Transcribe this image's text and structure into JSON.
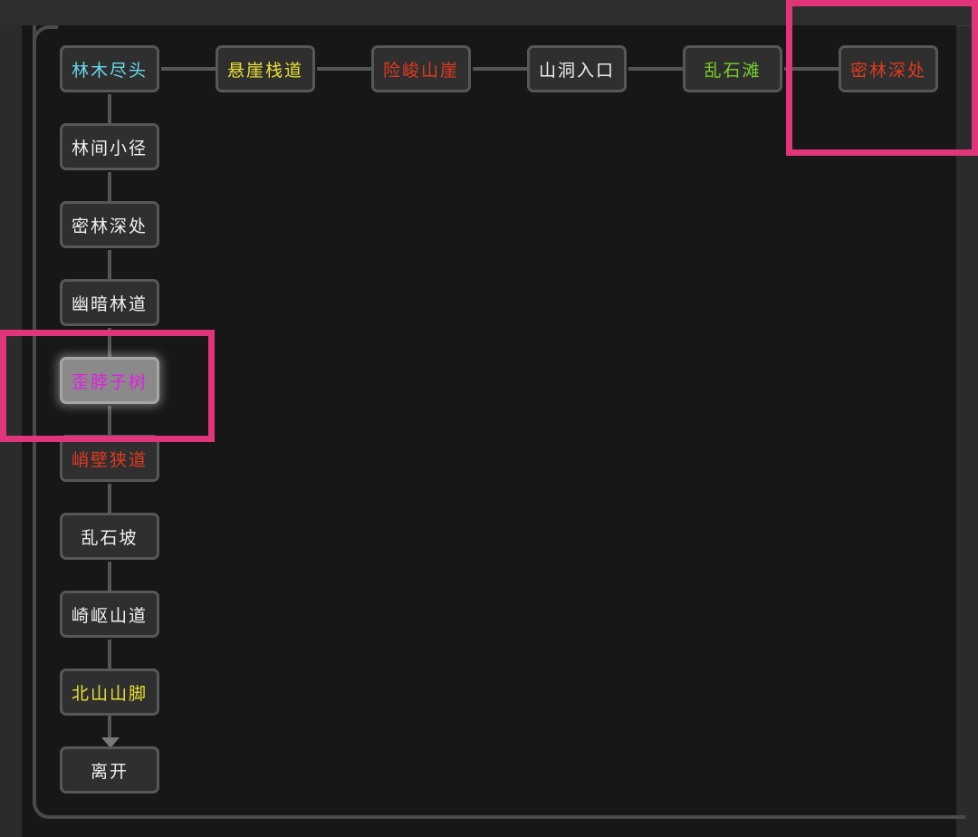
{
  "colors": {
    "cyan": "#68d8e8",
    "yellow": "#e8e030",
    "red": "#e03a1e",
    "white": "#f0f0f0",
    "green": "#78d028",
    "magenta": "#e020e0",
    "highlight": "#e0357a"
  },
  "top_row": [
    {
      "label": "林木尽头",
      "color": "cyan"
    },
    {
      "label": "悬崖栈道",
      "color": "yellow"
    },
    {
      "label": "险峻山崖",
      "color": "red"
    },
    {
      "label": "山洞入口",
      "color": "white"
    },
    {
      "label": "乱石滩",
      "color": "green"
    },
    {
      "label": "密林深处",
      "color": "red"
    }
  ],
  "left_column": [
    {
      "label": "林间小径",
      "color": "white"
    },
    {
      "label": "密林深处",
      "color": "white"
    },
    {
      "label": "幽暗林道",
      "color": "white"
    },
    {
      "label": "歪脖子树",
      "color": "magenta",
      "current": true
    },
    {
      "label": "峭壁狭道",
      "color": "red"
    },
    {
      "label": "乱石坡",
      "color": "white"
    },
    {
      "label": "崎岖山道",
      "color": "white"
    },
    {
      "label": "北山山脚",
      "color": "yellow"
    }
  ],
  "exit": {
    "label": "离开",
    "color": "white"
  }
}
